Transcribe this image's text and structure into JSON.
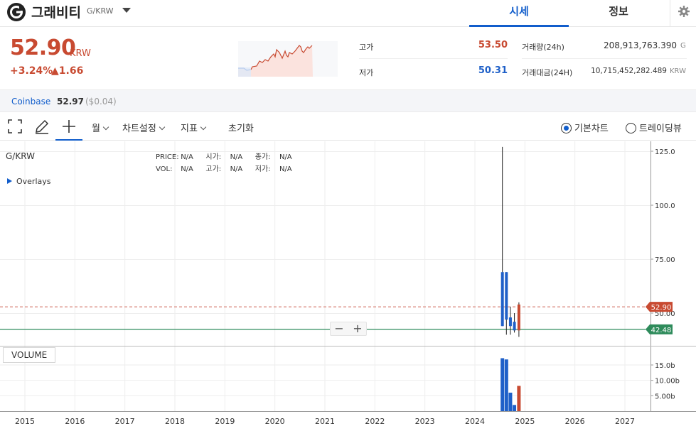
{
  "header": {
    "coin_name": "그래비티",
    "pair": "G/KRW",
    "tabs": [
      {
        "label": "시세",
        "active": true
      },
      {
        "label": "정보",
        "active": false
      }
    ]
  },
  "ticker": {
    "price": "52.90",
    "unit": "KRW",
    "change_pct": "+3.24%",
    "change_abs": "▲1.66",
    "high_label": "고가",
    "high_value": "53.50",
    "low_label": "저가",
    "low_value": "50.31",
    "volume_label": "거래량(24h)",
    "volume_value": "208,913,763.390",
    "volume_unit": "G",
    "amount_label": "거래대금(24H)",
    "amount_value": "10,715,452,282.489",
    "amount_unit": "KRW"
  },
  "exchange": {
    "name": "Coinbase",
    "price": "52.97",
    "diff": "($0.04)"
  },
  "toolbar": {
    "period": "월",
    "chart_settings": "차트설정",
    "indicators": "지표",
    "reset": "초기화",
    "radio_basic": "기본차트",
    "radio_trading": "트레이딩뷰"
  },
  "chart": {
    "symbol": "G/KRW",
    "ohlc": {
      "price_label": "PRICE:",
      "price_value": "N/A",
      "open_label": "시가:",
      "open_value": "N/A",
      "close_label": "종가:",
      "close_value": "N/A",
      "vol_label": "VOL:",
      "vol_value": "N/A",
      "high_label": "고가:",
      "high_value": "N/A",
      "low_label": "저가:",
      "low_value": "N/A"
    },
    "overlays_label": "Overlays",
    "volume_button": "VOLUME",
    "zoom_out": "−",
    "zoom_in": "+",
    "price_tag": "52.90",
    "line_tag": "42.48"
  },
  "chart_data": {
    "type": "candlestick",
    "x_ticks": [
      "2015",
      "2016",
      "2017",
      "2018",
      "2019",
      "2020",
      "2021",
      "2022",
      "2023",
      "2024",
      "2025",
      "2026",
      "2027"
    ],
    "y_ticks": [
      "125.0",
      "100.0",
      "75.00",
      "50.00"
    ],
    "volume_ticks": [
      "15.0b",
      "10.00b",
      "5.00b"
    ],
    "current_price": 52.9,
    "support_line": 42.48,
    "colors": {
      "up": "#c84a31",
      "down": "#1f60c8",
      "grid": "#eeeeee",
      "support": "#2e8b5b"
    },
    "candles": [
      {
        "t": 2024.55,
        "open": 69,
        "close": 44,
        "high": 127,
        "low": 44,
        "dir": "down",
        "volume_b": 17.2
      },
      {
        "t": 2024.63,
        "open": 69,
        "close": 47,
        "high": 69,
        "low": 40,
        "dir": "down",
        "volume_b": 16.8
      },
      {
        "t": 2024.71,
        "open": 48,
        "close": 44,
        "high": 53,
        "low": 40,
        "dir": "down",
        "volume_b": 6.0
      },
      {
        "t": 2024.79,
        "open": 46,
        "close": 42,
        "high": 50,
        "low": 41,
        "dir": "down",
        "volume_b": 2.0
      },
      {
        "t": 2024.88,
        "open": 42,
        "close": 54,
        "high": 55,
        "low": 39,
        "dir": "up",
        "volume_b": 8.2
      }
    ]
  }
}
